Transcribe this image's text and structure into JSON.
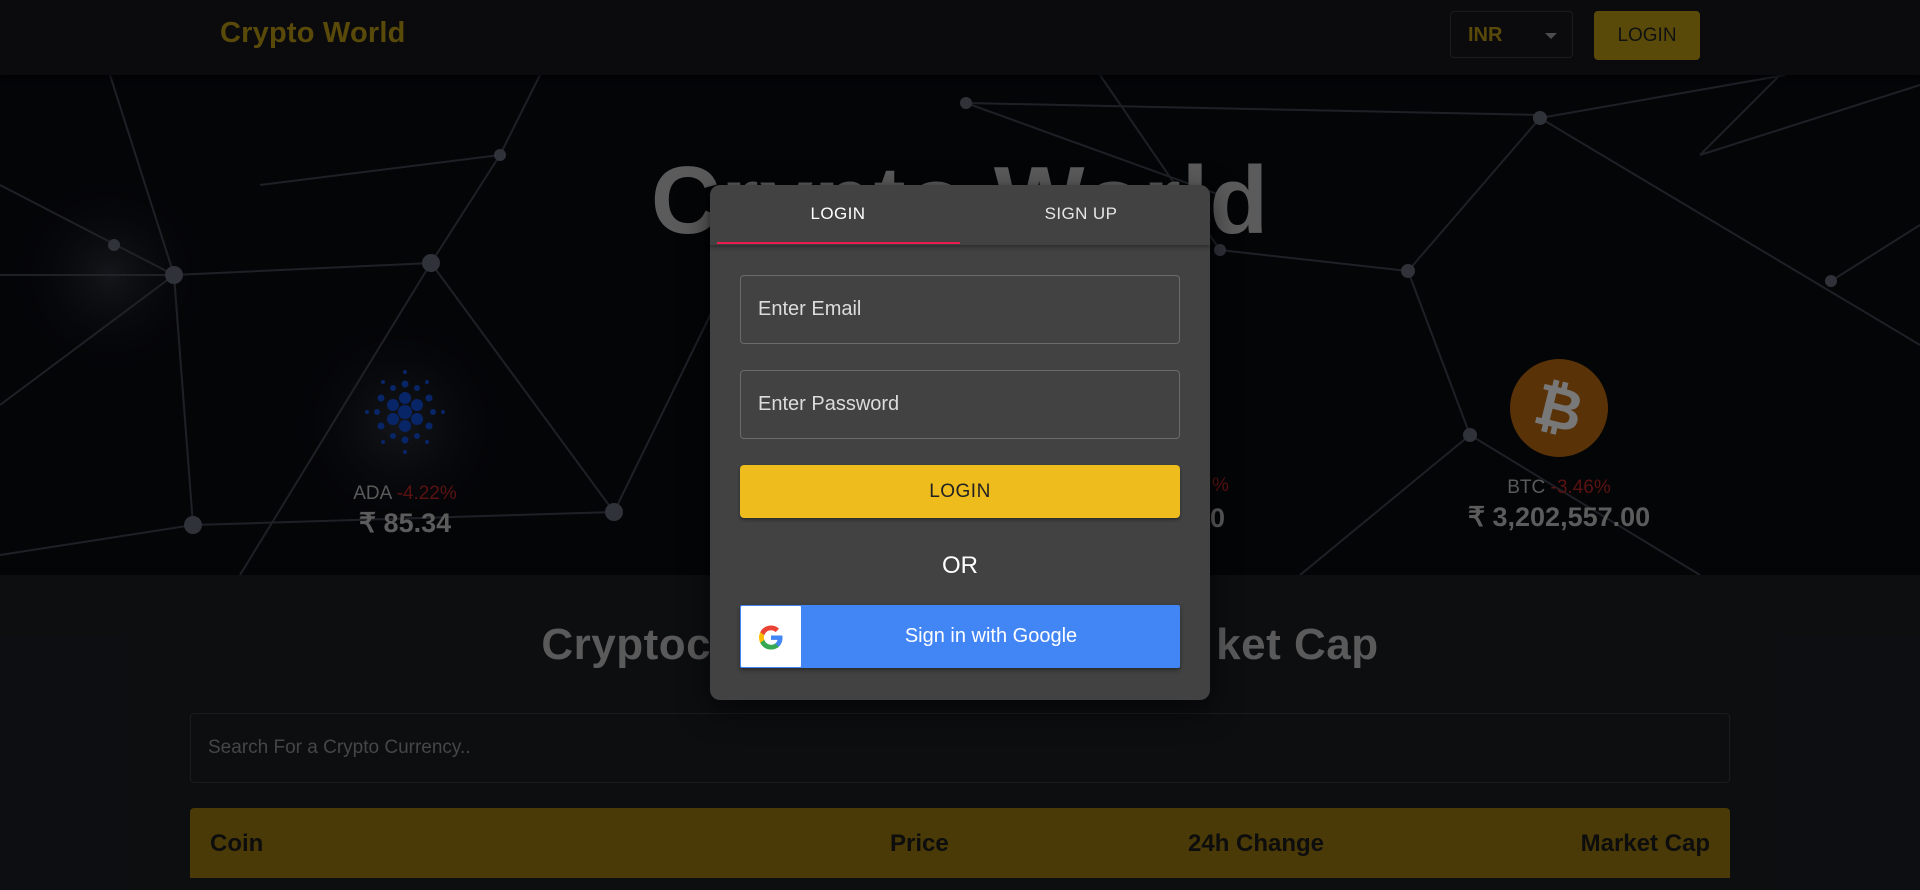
{
  "header": {
    "brand": "Crypto World",
    "currency": "INR",
    "login_label": "LOGIN"
  },
  "hero": {
    "title": "Crypto World",
    "coins": [
      {
        "symbol": "ADA",
        "change": "-4.22%",
        "price": "₹ 85.34",
        "icon": "cardano-icon"
      },
      {
        "symbol": "BTC",
        "change": "-3.46%",
        "price": "₹ 3,202,557.00",
        "icon": "bitcoin-icon"
      }
    ],
    "partial_change": "%",
    "partial_price": "0"
  },
  "section": {
    "title_left": "Cryptoc",
    "title_right": "ket Cap",
    "search_placeholder": "Search For a Crypto Currency.."
  },
  "table": {
    "headers": [
      "Coin",
      "Price",
      "24h Change",
      "Market Cap"
    ]
  },
  "modal": {
    "tabs": [
      "LOGIN",
      "SIGN UP"
    ],
    "active_tab": "LOGIN",
    "email_placeholder": "Enter Email",
    "password_placeholder": "Enter Password",
    "login_label": "LOGIN",
    "or_label": "OR",
    "google_label": "Sign in with Google"
  },
  "colors": {
    "accent": "#eebc1d",
    "tab_indicator": "#e91e4f",
    "google_blue": "#4285f4",
    "negative": "#8c1c1c"
  }
}
